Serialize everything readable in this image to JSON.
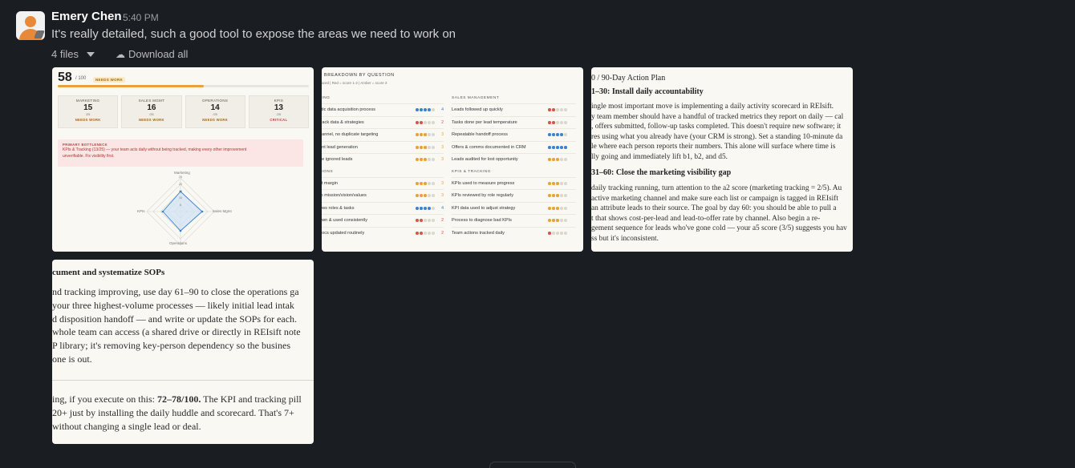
{
  "message": {
    "sender": "Emery Chen",
    "time": "5:40 PM",
    "text": "It's really detailed, such a good tool to expose the areas we need to work on",
    "files_count": "4 files",
    "download_all": "Download all"
  },
  "colors": {
    "background": "#1a1d21",
    "avatar_accent": "#e8893a",
    "warn": "#e8a23a",
    "critical": "#c43b3b",
    "blue": "#3b82d4",
    "green": "#3a9c5a"
  },
  "thumb1": {
    "score": "58",
    "score_of": "/ 100",
    "badge": "NEEDS WORK",
    "progress": 0.58,
    "categories": [
      {
        "name": "MARKETING",
        "value": "15",
        "denom": "/25",
        "status": "NEEDS WORK",
        "critical": false
      },
      {
        "name": "SALES MGMT",
        "value": "16",
        "denom": "/25",
        "status": "NEEDS WORK",
        "critical": false
      },
      {
        "name": "OPERATIONS",
        "value": "14",
        "denom": "/25",
        "status": "NEEDS WORK",
        "critical": false
      },
      {
        "name": "KPIS",
        "value": "13",
        "denom": "/25",
        "status": "CRITICAL",
        "critical": true
      }
    ],
    "bottleneck_label": "PRIMARY BOTTLENECK",
    "bottleneck_line1": "KPIs & Tracking (13/25) — your team acts daily without being tracked, making every other improvement",
    "bottleneck_line2": "unverifiable. Fix visibility first.",
    "radar": {
      "top": "Marketing",
      "left": "KPIs",
      "right": "Sales Mgmt",
      "bottom": "Operations",
      "tick_25": "25",
      "tick_20": "20",
      "tick_15": "15",
      "tick_10": "10",
      "tick_5": "5"
    }
  },
  "thumb2": {
    "header": "BREAKDOWN BY QUESTION",
    "legend": "ared  |  Red = score 1-2  |  Amber = score 3",
    "left_sections": [
      {
        "title": "TING",
        "rows": [
          {
            "q": "stic data acquisition process",
            "score": "4",
            "color": "blue"
          },
          {
            "q": "track data & strategies",
            "score": "2",
            "color": "red"
          },
          {
            "q": "hannel, no duplicate targeting",
            "score": "3",
            "color": "amber"
          },
          {
            "q": "ent lead generation",
            "score": "3",
            "color": "amber"
          },
          {
            "q": "ge ignored leads",
            "score": "3",
            "color": "amber"
          }
        ]
      },
      {
        "title": "TIONS",
        "rows": [
          {
            "q": "fit margin",
            "score": "3",
            "color": "amber"
          },
          {
            "q": "to mission/vision/values",
            "score": "3",
            "color": "amber"
          },
          {
            "q": "ows roles & tasks",
            "score": "4",
            "color": "blue"
          },
          {
            "q": "own & used consistently",
            "score": "2",
            "color": "red"
          },
          {
            "q": "docs updated routinely",
            "score": "2",
            "color": "red"
          }
        ]
      }
    ],
    "right_sections": [
      {
        "title": "SALES MANAGEMENT",
        "rows": [
          {
            "q": "Leads followed up quickly",
            "score": "",
            "color": "red"
          },
          {
            "q": "Tasks done per lead temperature",
            "score": "",
            "color": "red"
          },
          {
            "q": "Repeatable handoff process",
            "score": "",
            "color": "blue"
          },
          {
            "q": "Offers & comms documented in CRM",
            "score": "",
            "color": "blue5"
          },
          {
            "q": "Leads audited for lost opportunity",
            "score": "",
            "color": "amber"
          }
        ]
      },
      {
        "title": "KPIS & TRACKING",
        "rows": [
          {
            "q": "KPIs used to measure progress",
            "score": "",
            "color": "amber"
          },
          {
            "q": "KPIs reviewed by role regularly",
            "score": "",
            "color": "amber"
          },
          {
            "q": "KPI data used to adjust strategy",
            "score": "",
            "color": "amber"
          },
          {
            "q": "Process to diagnose bad KPIs",
            "score": "",
            "color": "amber"
          },
          {
            "q": "Team actions tracked daily",
            "score": "",
            "color": "red1"
          }
        ]
      }
    ]
  },
  "thumb3": {
    "title": "0 / 90-Day Action Plan",
    "h1": "1–30: Install daily accountability",
    "p1": [
      "ingle most important move is implementing a daily activity scorecard in REIsift.",
      "y team member should have a handful of tracked metrics they report on daily — cal",
      ", offers submitted, follow-up tasks completed. This doesn't require new software; it",
      "res using what you already have (your CRM is strong). Set a standing 10-minute da",
      "le where each person reports their numbers. This alone will surface where time is",
      "lly going and immediately lift b1, b2, and d5."
    ],
    "h2": "31–60: Close the marketing visibility gap",
    "p2": [
      "daily tracking running, turn attention to the a2 score (marketing tracking = 2/5). Au",
      " active marketing channel and make sure each list or campaign is tagged in REIsift",
      "an attribute leads to their source. The goal by day 60: you should be able to pull a",
      "t that shows cost-per-lead and lead-to-offer rate by channel. Also begin a re-",
      "gement sequence for leads who've gone cold — your a5 score (3/5) suggests you hav",
      "ss but it's inconsistent."
    ]
  },
  "thumb4": {
    "heading": "cument and systematize SOPs",
    "p1": [
      "nd tracking improving, use day 61–90 to close the operations ga",
      " your three highest-volume processes — likely initial lead intak",
      "d disposition handoff — and write or update the SOPs for each.",
      "whole team can access (a shared drive or directly in REIsift note",
      "P library; it's removing key-person dependency so the busines",
      "one is out."
    ],
    "p2_a": "ing, if you execute on this: ",
    "p2_bold": "72–78/100.",
    "p2_b": " The KPI and tracking pill",
    "p2_line2": "20+ just by installing the daily huddle and scorecard. That's 7+",
    "p2_line3": " without changing a single lead or deal."
  }
}
